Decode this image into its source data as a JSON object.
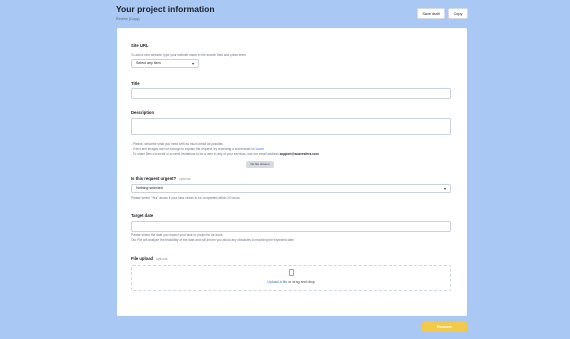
{
  "header": {
    "title": "Your project information",
    "subtitle": "Review (Copy)",
    "save_draft_label": "Save draft",
    "copy_label": "Copy"
  },
  "site_url": {
    "label": "Site URL",
    "help": "To add a new website, type your website name in the search field and press enter",
    "select_value": "Select any item"
  },
  "title_field": {
    "label": "Title",
    "value": ""
  },
  "description": {
    "label": "Description",
    "value": "",
    "help_1": "- Please, describe what you need with as much detail as possible.",
    "help_2_prefix": "- If text and images are not enough to explain the request, try recording a screencast on ",
    "help_2_link": "Loom",
    "help_3_prefix": "- To share files via email or to send invitations to be a user in any of your services, use our email address ",
    "help_3_email": "support@suavesfera.com",
    "file_button": "No file chosen"
  },
  "urgent": {
    "label": "Is this request urgent?",
    "optional": "optional",
    "select_value": "Nothing selected",
    "help": "Please select \"Yes\" above if your task needs to be completed within 24 hours."
  },
  "target_date": {
    "label": "Target date",
    "value": "",
    "help_1": "Please select the date you expect your task or project to be done.",
    "help_2": "Our PM will analyze the feasibility of the date and will inform you about any obstacles to reaching the expected date."
  },
  "file_upload": {
    "label": "File upload",
    "optional": "optional",
    "link_text": "Upload a file",
    "suffix_text": " or drag and drop"
  },
  "footer": {
    "resume_label": "Resume"
  },
  "colors": {
    "background": "#a9c8f4",
    "accent": "#f4c947",
    "link": "#2f6fd6"
  }
}
